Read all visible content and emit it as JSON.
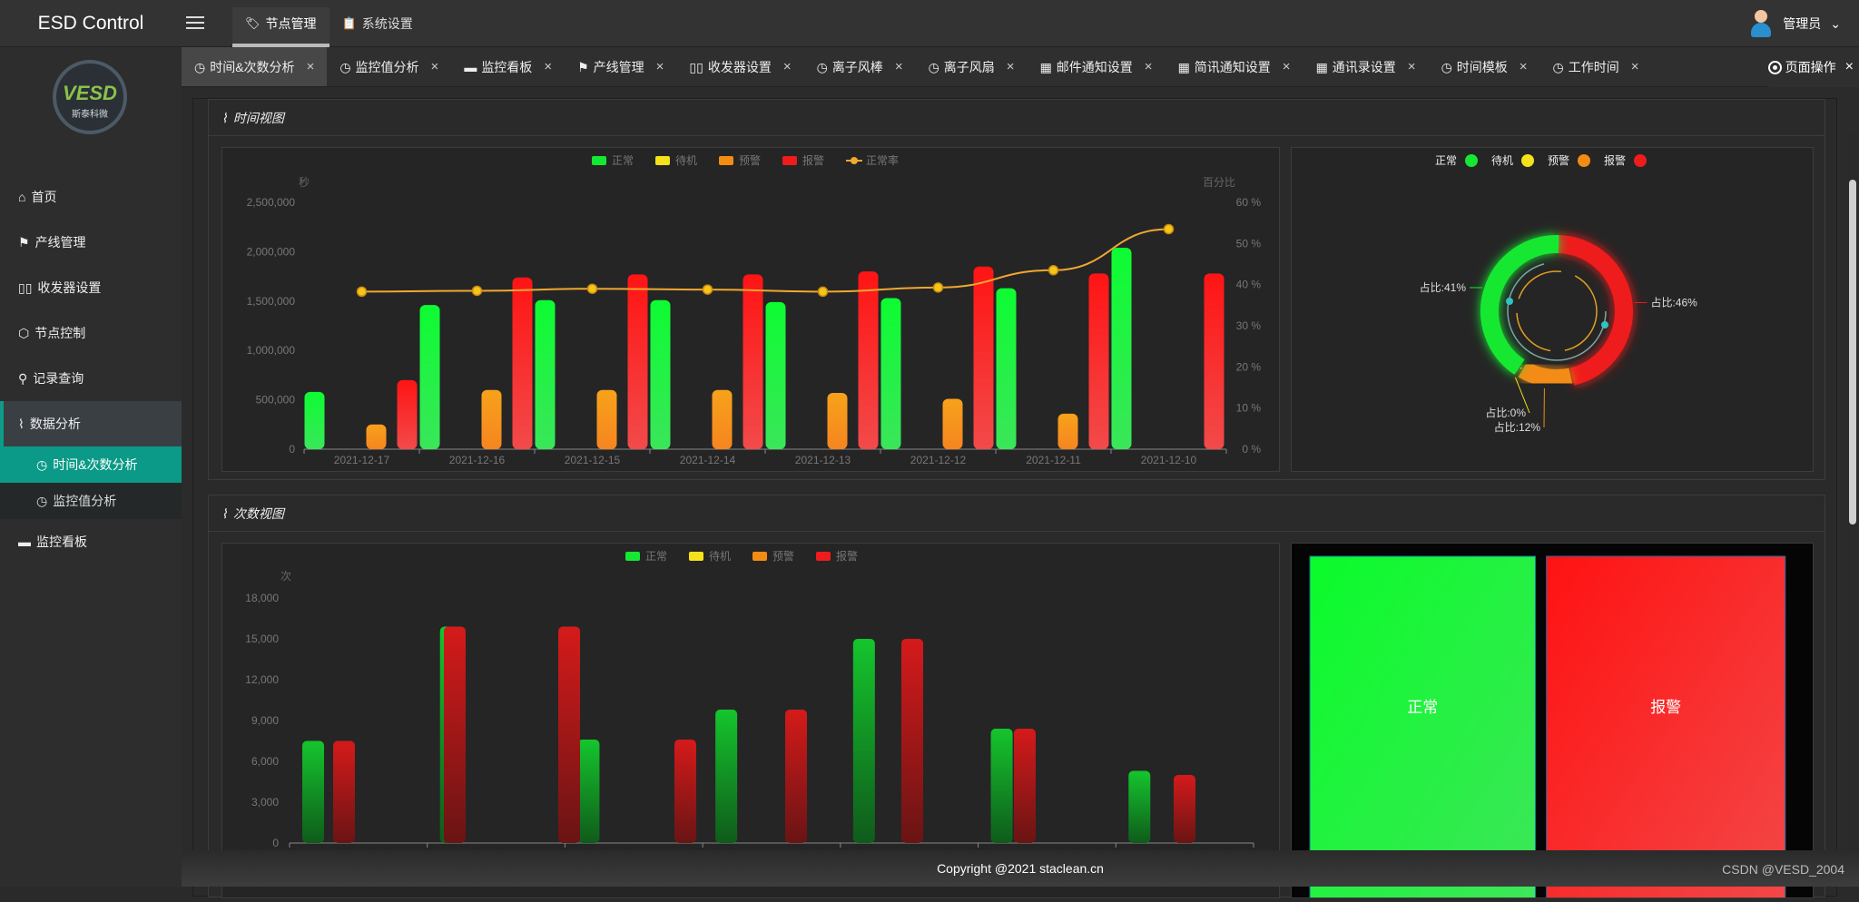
{
  "app": {
    "title": "ESD Control"
  },
  "topnav": [
    {
      "label": "节点管理",
      "icon": "tag-icon",
      "active": true
    },
    {
      "label": "系统设置",
      "icon": "clipboard-icon",
      "active": false
    }
  ],
  "user": {
    "name": "管理员"
  },
  "logo": {
    "brand": "VESD",
    "sub": "斯泰科微"
  },
  "sidebar": {
    "items": [
      {
        "label": "首页",
        "icon": "home-icon"
      },
      {
        "label": "产线管理",
        "icon": "flag-icon"
      },
      {
        "label": "收发器设置",
        "icon": "columns-icon"
      },
      {
        "label": "节点控制",
        "icon": "cube-icon"
      },
      {
        "label": "记录查询",
        "icon": "search-icon"
      },
      {
        "label": "数据分析",
        "icon": "pulse-icon"
      },
      {
        "label": "监控看板",
        "icon": "monitor-icon"
      }
    ],
    "sub": [
      {
        "label": "时间&次数分析",
        "icon": "clock-icon"
      },
      {
        "label": "监控值分析",
        "icon": "clock-icon"
      }
    ]
  },
  "tabs": [
    {
      "label": "时间&次数分析",
      "icon": "clock-icon"
    },
    {
      "label": "监控值分析",
      "icon": "clock-icon"
    },
    {
      "label": "监控看板",
      "icon": "monitor-icon"
    },
    {
      "label": "产线管理",
      "icon": "flag-icon"
    },
    {
      "label": "收发器设置",
      "icon": "columns-icon"
    },
    {
      "label": "离子风棒",
      "icon": "clock-icon"
    },
    {
      "label": "离子风扇",
      "icon": "clock-icon"
    },
    {
      "label": "邮件通知设置",
      "icon": "building-icon"
    },
    {
      "label": "简讯通知设置",
      "icon": "building-icon"
    },
    {
      "label": "通讯录设置",
      "icon": "building-icon"
    },
    {
      "label": "时间模板",
      "icon": "clock-icon"
    },
    {
      "label": "工作时间",
      "icon": "clock-icon"
    }
  ],
  "tab_more": {
    "label": "页面操作"
  },
  "time_view": {
    "title": "时间视图"
  },
  "count_view": {
    "title": "次数视图"
  },
  "colors": {
    "normal": "#14e832",
    "standby": "#f5e21b",
    "warning": "#f28c12",
    "alarm": "#ee1c1c",
    "rate": "#f0a830"
  },
  "chart_data": [
    {
      "type": "bar",
      "legend": [
        "正常",
        "待机",
        "预警",
        "报警",
        "正常率"
      ],
      "ylabel": "秒",
      "y2label": "百分比",
      "categories": [
        "2021-12-17",
        "2021-12-16",
        "2021-12-15",
        "2021-12-14",
        "2021-12-13",
        "2021-12-12",
        "2021-12-11",
        "2021-12-10"
      ],
      "y_ticks": [
        "0",
        "500,000",
        "1,000,000",
        "1,500,000",
        "2,000,000",
        "2,500,000"
      ],
      "y2_ticks": [
        "0 %",
        "10 %",
        "20 %",
        "30 %",
        "40 %",
        "50 %",
        "60 %"
      ],
      "ylim": [
        0,
        2500000
      ],
      "y2lim": [
        0,
        60
      ],
      "series": [
        {
          "name": "正常",
          "values": [
            580000,
            1460000,
            1510000,
            1510000,
            1490000,
            1530000,
            1630000,
            2040000
          ]
        },
        {
          "name": "待机",
          "values": [
            0,
            0,
            0,
            0,
            0,
            0,
            0,
            0
          ]
        },
        {
          "name": "预警",
          "values": [
            250000,
            600000,
            600000,
            600000,
            570000,
            510000,
            360000,
            0
          ]
        },
        {
          "name": "报警",
          "values": [
            700000,
            1740000,
            1770000,
            1770000,
            1800000,
            1850000,
            1780000,
            1780000
          ]
        }
      ],
      "line": {
        "name": "正常率",
        "values": [
          38.3,
          38.5,
          39.0,
          38.8,
          38.3,
          39.3,
          43.5,
          53.5
        ]
      }
    },
    {
      "type": "pie",
      "legend": [
        "正常",
        "待机",
        "预警",
        "报警"
      ],
      "slices": [
        {
          "name": "报警",
          "value": 46,
          "label": "占比:46%"
        },
        {
          "name": "预警",
          "value": 12,
          "label": "占比:12%"
        },
        {
          "name": "待机",
          "value": 0,
          "label": "占比:0%"
        },
        {
          "name": "正常",
          "value": 41,
          "label": "占比:41%"
        }
      ]
    },
    {
      "type": "bar",
      "legend": [
        "正常",
        "待机",
        "预警",
        "报警"
      ],
      "ylabel": "次",
      "y_ticks": [
        "0",
        "3,000",
        "6,000",
        "9,000",
        "12,000",
        "15,000",
        "18,000"
      ],
      "ylim": [
        0,
        18000
      ],
      "series": [
        {
          "name": "正常",
          "values": [
            7500,
            15900,
            7600,
            9800,
            15000,
            8400,
            5300
          ]
        },
        {
          "name": "待机",
          "values": [
            0,
            0,
            0,
            0,
            0,
            0,
            0
          ]
        },
        {
          "name": "预警",
          "values": [
            0,
            0,
            0,
            0,
            0,
            0,
            0
          ]
        },
        {
          "name": "报警",
          "values": [
            7500,
            15900,
            15900,
            7600,
            9800,
            15000,
            8400,
            5000
          ]
        }
      ]
    },
    {
      "type": "treemap",
      "cells": [
        {
          "name": "正常",
          "value": 41
        },
        {
          "name": "报警",
          "value": 46
        }
      ]
    }
  ],
  "footer": {
    "copyright": "Copyright @2021 staclean.cn"
  },
  "watermark": "CSDN @VESD_2004"
}
